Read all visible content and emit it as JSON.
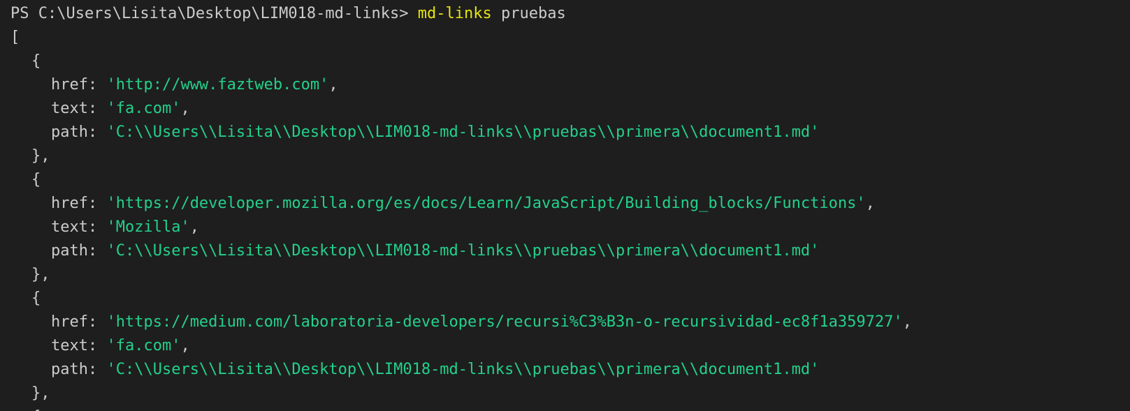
{
  "prompt": {
    "path": "PS C:\\Users\\Lisita\\Desktop\\LIM018-md-links>",
    "command": "md-links",
    "argument": "pruebas"
  },
  "output": {
    "open_bracket": "[",
    "open_brace": "{",
    "close_brace": "},",
    "entries": [
      {
        "href": "'http://www.faztweb.com'",
        "text": "'fa.com'",
        "path": "'C:\\\\Users\\\\Lisita\\\\Desktop\\\\LIM018-md-links\\\\pruebas\\\\primera\\\\document1.md'"
      },
      {
        "href": "'https://developer.mozilla.org/es/docs/Learn/JavaScript/Building_blocks/Functions'",
        "text": "'Mozilla'",
        "path": "'C:\\\\Users\\\\Lisita\\\\Desktop\\\\LIM018-md-links\\\\pruebas\\\\primera\\\\document1.md'"
      },
      {
        "href": "'https://medium.com/laboratoria-developers/recursi%C3%B3n-o-recursividad-ec8f1a359727'",
        "text": "'fa.com'",
        "path": "'C:\\\\Users\\\\Lisita\\\\Desktop\\\\LIM018-md-links\\\\pruebas\\\\primera\\\\document1.md'"
      }
    ],
    "labels": {
      "href": "href: ",
      "text": "text: ",
      "path": "path: ",
      "comma": ","
    }
  },
  "colors": {
    "background": "#1e1e1e",
    "foreground": "#cccccc",
    "command": "#e5e510",
    "string": "#23d18b"
  }
}
